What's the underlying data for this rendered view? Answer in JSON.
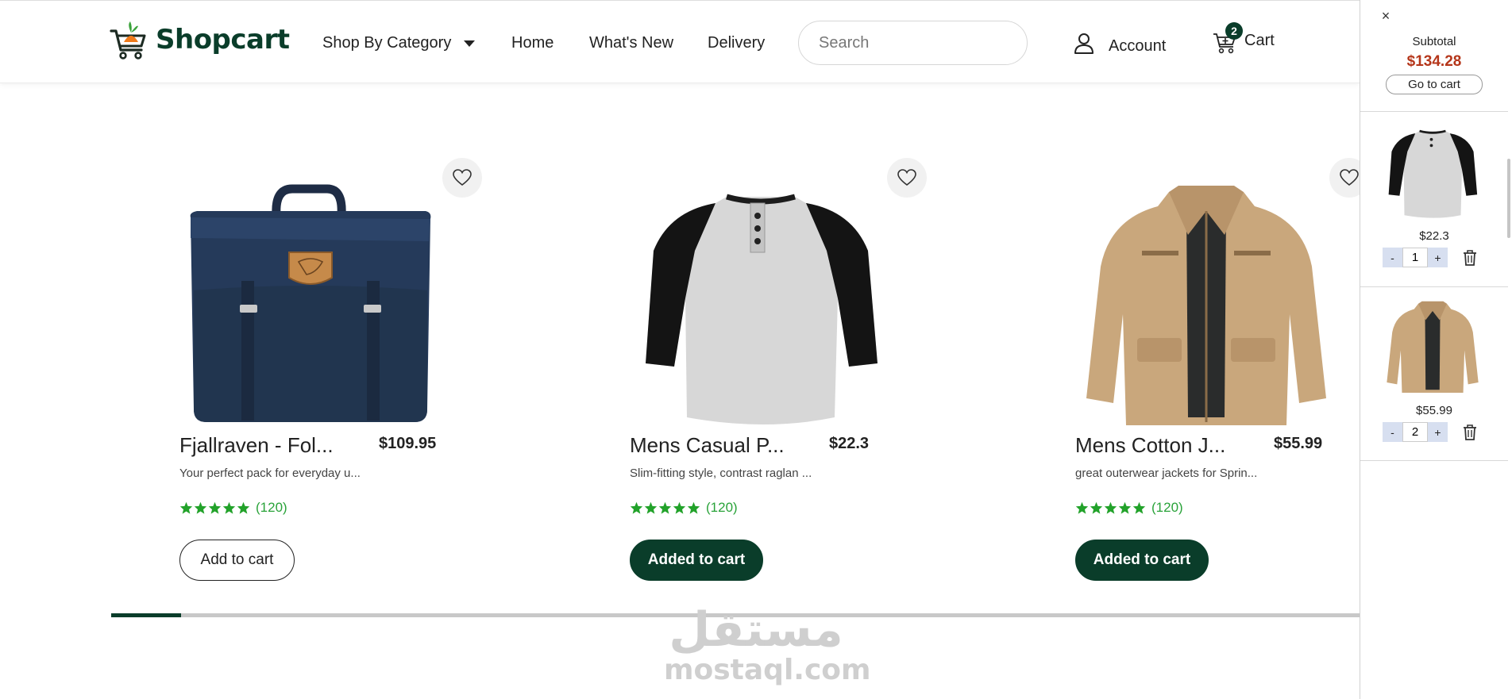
{
  "header": {
    "logo_text": "Shopcart",
    "nav": {
      "category": "Shop By Category",
      "home": "Home",
      "whats_new": "What's New",
      "delivery": "Delivery"
    },
    "search": {
      "placeholder": "Search",
      "value": ""
    },
    "account_label": "Account",
    "cart_label": "Cart",
    "cart_count": "2"
  },
  "products": [
    {
      "name": "Fjallraven - Fol...",
      "price": "$109.95",
      "description": "Your perfect pack for everyday u...",
      "rating_count": "(120)",
      "stars": 5,
      "button_label": "Add to cart",
      "in_cart": false
    },
    {
      "name": "Mens Casual P...",
      "price": "$22.3",
      "description": "Slim-fitting style, contrast raglan ...",
      "rating_count": "(120)",
      "stars": 5,
      "button_label": "Added to cart",
      "in_cart": true
    },
    {
      "name": "Mens Cotton J...",
      "price": "$55.99",
      "description": "great outerwear jackets for Sprin...",
      "rating_count": "(120)",
      "stars": 5,
      "button_label": "Added to cart",
      "in_cart": true
    }
  ],
  "carousel": {
    "progress_fraction": 0.056
  },
  "side_cart": {
    "close_symbol": "×",
    "subtitle": "Subtotal",
    "subtotal": "$134.28",
    "go_to_cart": "Go to cart",
    "items": [
      {
        "price": "$22.3",
        "qty": "1",
        "minus": "-",
        "plus": "+"
      },
      {
        "price": "$55.99",
        "qty": "2",
        "minus": "-",
        "plus": "+"
      }
    ]
  },
  "watermark": {
    "arabic": "مستقل",
    "latin": "mostaql.com"
  },
  "colors": {
    "brand": "#0a3d2a",
    "star": "#22a22a",
    "subtotal": "#b5361a",
    "qty_button": "#d7dff0"
  }
}
